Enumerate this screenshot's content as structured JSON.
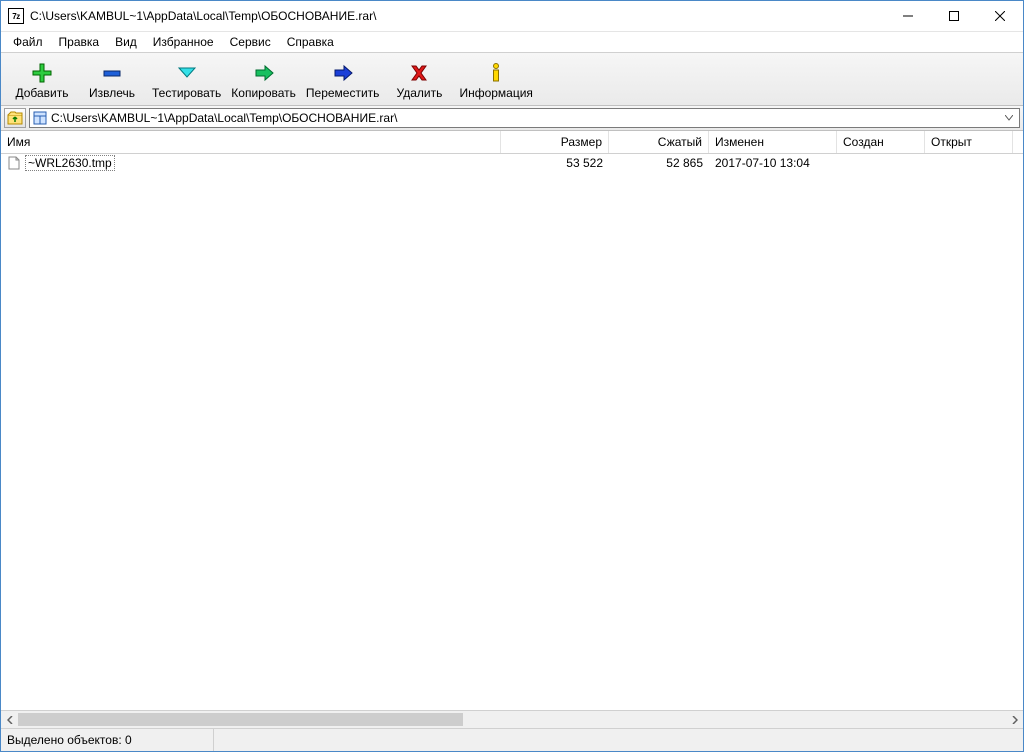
{
  "app_icon_label": "7z",
  "window_title": "C:\\Users\\KAMBUL~1\\AppData\\Local\\Temp\\ОБОСНОВАНИЕ.rar\\",
  "menu": {
    "file": "Файл",
    "edit": "Правка",
    "view": "Вид",
    "fav": "Избранное",
    "tools": "Сервис",
    "help": "Справка"
  },
  "toolbar": {
    "add": "Добавить",
    "extract": "Извлечь",
    "test": "Тестировать",
    "copy": "Копировать",
    "move": "Переместить",
    "delete": "Удалить",
    "info": "Информация"
  },
  "address_path": "C:\\Users\\KAMBUL~1\\AppData\\Local\\Temp\\ОБОСНОВАНИЕ.rar\\",
  "columns": {
    "name": "Имя",
    "size": "Размер",
    "packed": "Сжатый",
    "modified": "Изменен",
    "created": "Создан",
    "opened": "Открыт"
  },
  "files": [
    {
      "name": "~WRL2630.tmp",
      "size": "53 522",
      "packed": "52 865",
      "modified": "2017-07-10 13:04",
      "created": "",
      "opened": ""
    }
  ],
  "statusbar": {
    "selection": "Выделено объектов: 0"
  }
}
